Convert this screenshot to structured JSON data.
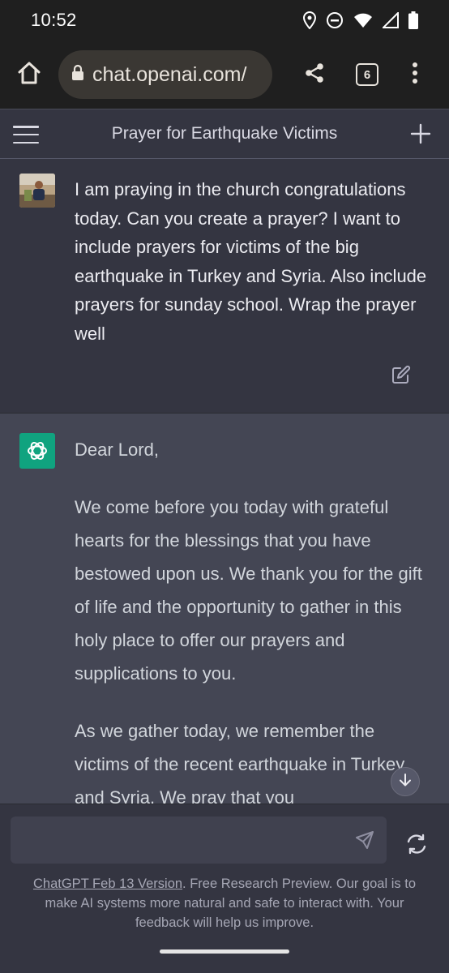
{
  "status_bar": {
    "time": "10:52",
    "icons": [
      "location-icon",
      "do-not-disturb-icon",
      "wifi-icon",
      "signal-icon",
      "battery-icon"
    ]
  },
  "browser": {
    "url": "chat.openai.com/",
    "tab_count": "6",
    "icons": [
      "home-icon",
      "lock-icon",
      "share-icon",
      "tabs-icon",
      "more-vert-icon"
    ]
  },
  "chat": {
    "title": "Prayer for Earthquake Victims"
  },
  "user_message": {
    "text": "I am praying in the church congratulations today. Can you create a prayer? I want to include prayers for victims of the big earthquake in Turkey and Syria. Also include prayers for sunday school. Wrap the prayer well"
  },
  "assistant_message": {
    "paragraphs": [
      "Dear Lord,",
      "We come before you today with grateful hearts for the blessings that you have bestowed upon us. We thank you for the gift of life and the opportunity to gather in this holy place to offer our prayers and supplications to you.",
      "As we gather today, we remember the victims of the recent earthquake in Turkey and Syria. We pray that you"
    ]
  },
  "footer": {
    "input_value": "",
    "version_link": "ChatGPT Feb 13 Version",
    "disclaimer_text": ". Free Research Preview. Our goal is to make AI systems more natural and safe to interact with. Your feedback will help us improve."
  },
  "colors": {
    "background": "#343541",
    "assistant_background": "#444654",
    "accent": "#10a37f",
    "browser_chrome": "#1f1f1f"
  }
}
